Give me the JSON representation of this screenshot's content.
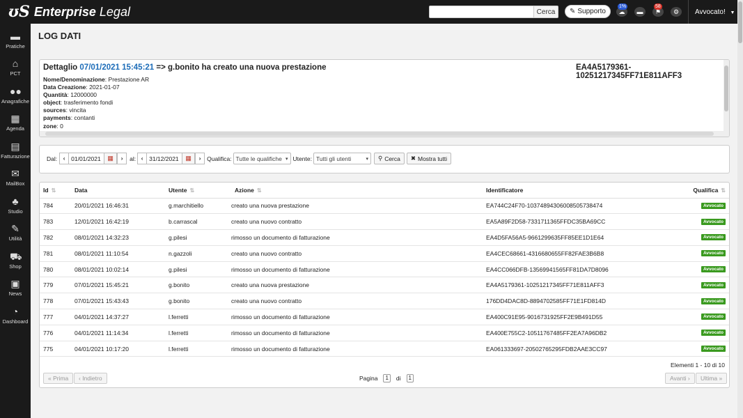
{
  "app": {
    "brand": "Enterprise Legal",
    "brand_bold": "Enterprise",
    "brand_rest": "Legal"
  },
  "topbar": {
    "search_button": "Cerca",
    "support_label": "Supporto",
    "cloud_badge": "1%",
    "flag_badge": "58",
    "user_label": "Avvocato!"
  },
  "sidebar": {
    "items": [
      {
        "label": "Pratiche",
        "icon": "folder-icon"
      },
      {
        "label": "PCT",
        "icon": "bank-icon"
      },
      {
        "label": "Anagrafiche",
        "icon": "users-icon"
      },
      {
        "label": "Agenda",
        "icon": "calendar-icon"
      },
      {
        "label": "Fatturazione",
        "icon": "calculator-icon"
      },
      {
        "label": "MailBox",
        "icon": "envelope-icon"
      },
      {
        "label": "Studio",
        "icon": "user-group-icon"
      },
      {
        "label": "Utilità",
        "icon": "wrench-icon"
      },
      {
        "label": "Shop",
        "icon": "cart-icon"
      },
      {
        "label": "News",
        "icon": "newspaper-icon"
      },
      {
        "label": "Dashboard",
        "icon": "gauge-icon"
      }
    ]
  },
  "page": {
    "title": "LOG DATI"
  },
  "detail": {
    "prefix": "Dettaglio",
    "datetime": "07/01/2021 15:45:21",
    "action_text": "=> g.bonito ha creato una nuova prestazione",
    "identifier": "EA4A5179361-10251217345FF71E811AFF3",
    "fields": [
      {
        "key": "Nome/Denominazione",
        "value": "Prestazione AR"
      },
      {
        "key": "Data Creazione",
        "value": "2021-01-07"
      },
      {
        "key": "Quantità",
        "value": "12000000"
      },
      {
        "key": "object",
        "value": "trasferimento fondi"
      },
      {
        "key": "sources",
        "value": "vincita"
      },
      {
        "key": "payments",
        "value": "contanti"
      },
      {
        "key": "zone",
        "value": "0"
      }
    ]
  },
  "filters": {
    "dal_label": "Dal:",
    "dal_value": "01/01/2021",
    "al_label": "al:",
    "al_value": "31/12/2021",
    "qualifica_label": "Qualifica:",
    "qualifica_value": "Tutte le qualifiche",
    "utente_label": "Utente:",
    "utente_value": "Tutti gli utenti",
    "search_button": "Cerca",
    "show_all_button": "Mostra tutti"
  },
  "table": {
    "headers": {
      "id": "Id",
      "data": "Data",
      "utente": "Utente",
      "azione": "Azione",
      "identificatore": "Identificatore",
      "qualifica": "Qualifica"
    },
    "rows": [
      {
        "id": "784",
        "data": "20/01/2021 16:46:31",
        "utente": "g.marchitiello",
        "azione": "creato una nuova prestazione",
        "identificatore": "EA744C24F70-10374894306008505738474",
        "qualifica": "Avvocato"
      },
      {
        "id": "783",
        "data": "12/01/2021 16:42:19",
        "utente": "b.carrascal",
        "azione": "creato una nuovo contratto",
        "identificatore": "EA5A89F2D58-7331711365FFDC35BA69CC",
        "qualifica": "Avvocato"
      },
      {
        "id": "782",
        "data": "08/01/2021 14:32:23",
        "utente": "g.pilesi",
        "azione": "rimosso un documento di fatturazione",
        "identificatore": "EA4D5FA56A5-9661299635FF85EE1D1E64",
        "qualifica": "Avvocato"
      },
      {
        "id": "781",
        "data": "08/01/2021 11:10:54",
        "utente": "n.gazzoli",
        "azione": "creato una nuovo contratto",
        "identificatore": "EA4CEC68661-4316680655FF82FAE3B6B8",
        "qualifica": "Avvocato"
      },
      {
        "id": "780",
        "data": "08/01/2021 10:02:14",
        "utente": "g.pilesi",
        "azione": "rimosso un documento di fatturazione",
        "identificatore": "EA4CC066DFB-13569941565FF81DA7D8096",
        "qualifica": "Avvocato"
      },
      {
        "id": "779",
        "data": "07/01/2021 15:45:21",
        "utente": "g.bonito",
        "azione": "creato una nuova prestazione",
        "identificatore": "EA4A5179361-10251217345FF71E811AFF3",
        "qualifica": "Avvocato"
      },
      {
        "id": "778",
        "data": "07/01/2021 15:43:43",
        "utente": "g.bonito",
        "azione": "creato una nuovo contratto",
        "identificatore": "176DD4DAC8D-8894702585FF71E1FD814D",
        "qualifica": "Avvocato"
      },
      {
        "id": "777",
        "data": "04/01/2021 14:37:27",
        "utente": "l.ferretti",
        "azione": "rimosso un documento di fatturazione",
        "identificatore": "EA400C91E95-9016731925FF2E9B491D55",
        "qualifica": "Avvocato"
      },
      {
        "id": "776",
        "data": "04/01/2021 11:14:34",
        "utente": "l.ferretti",
        "azione": "rimosso un documento di fatturazione",
        "identificatore": "EA400E755C2-10511767485FF2EA7A96DB2",
        "qualifica": "Avvocato"
      },
      {
        "id": "775",
        "data": "04/01/2021 10:17:20",
        "utente": "l.ferretti",
        "azione": "rimosso un documento di fatturazione",
        "identificatore": "EA061333697-20502765295FDB2AAE3CC97",
        "qualifica": "Avvocato"
      }
    ],
    "summary": "Elementi 1 - 10 di 10"
  },
  "pagination": {
    "first": "« Prima",
    "prev": "‹ Indietro",
    "page_label": "Pagina",
    "current": "1",
    "of_label": "di",
    "total": "1",
    "next": "Avanti ›",
    "last": "Ultima »"
  },
  "colors": {
    "topbar_bg": "#1a1a1a",
    "link_blue": "#1c6cb8",
    "badge_green": "#3a9a1f",
    "badge_blue": "#2a5bd7",
    "badge_red": "#d9342b"
  }
}
